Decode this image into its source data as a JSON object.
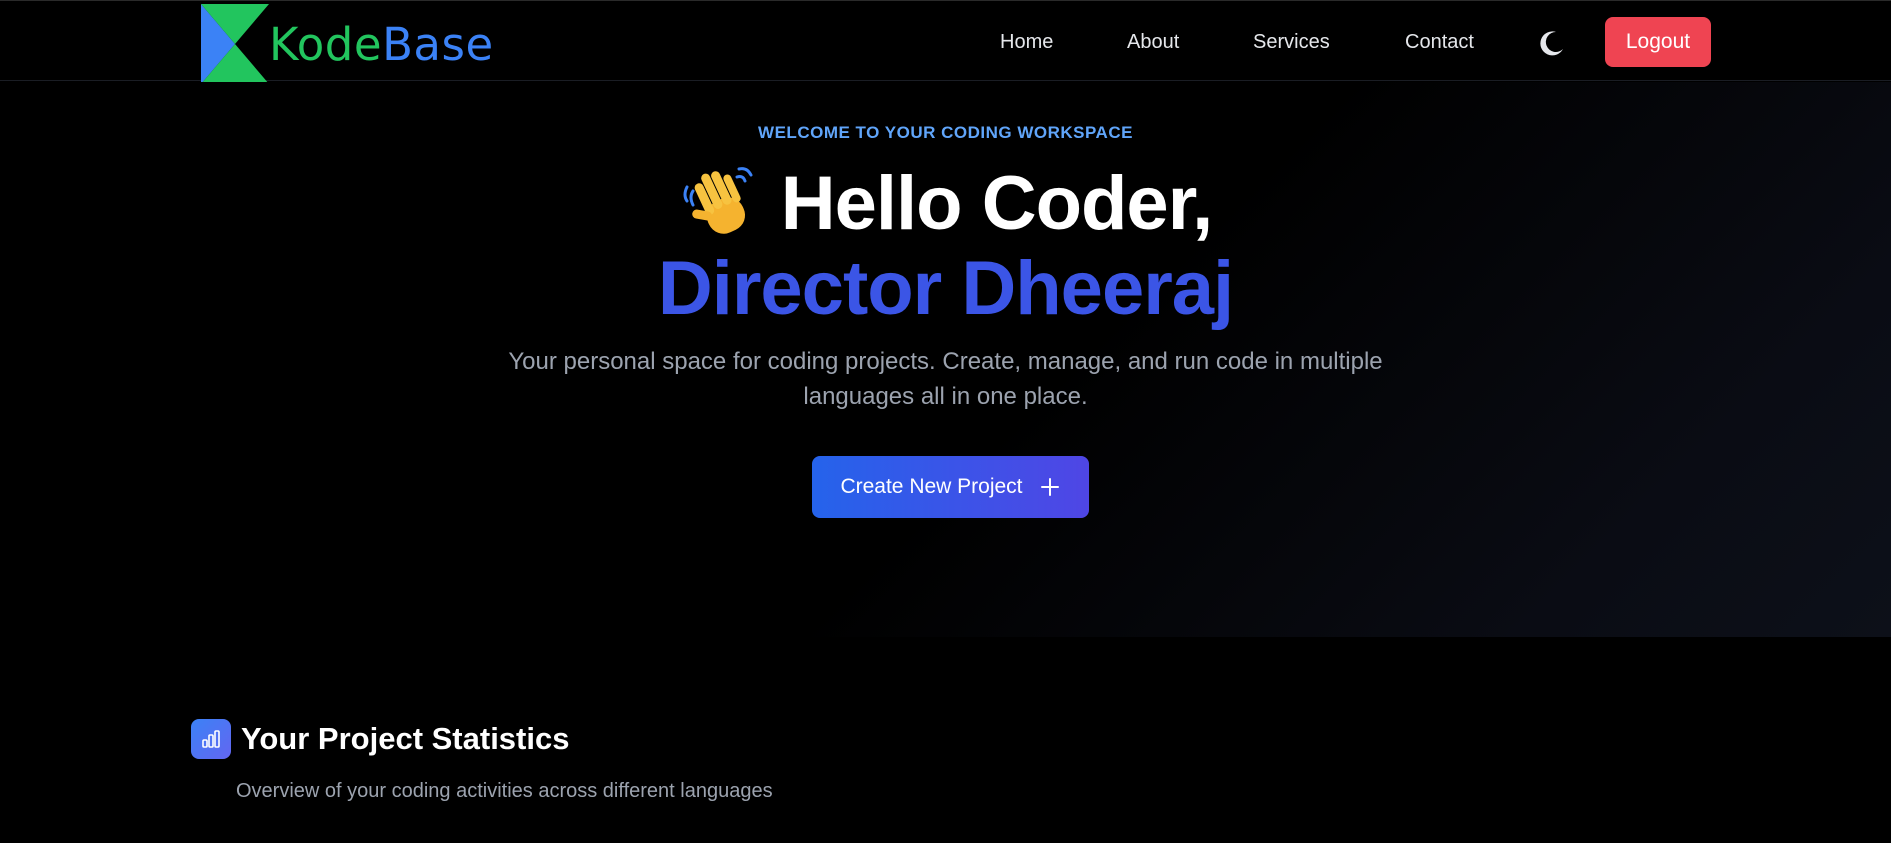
{
  "navbar": {
    "logo": {
      "part1": "Kode",
      "part2": "Base"
    },
    "links": [
      {
        "label": "Home"
      },
      {
        "label": "About"
      },
      {
        "label": "Services"
      },
      {
        "label": "Contact"
      }
    ],
    "theme_icon": "moon-icon",
    "logout_label": "Logout"
  },
  "hero": {
    "eyebrow": "WELCOME TO YOUR CODING WORKSPACE",
    "greeting": "Hello Coder,",
    "greeting_icon": "waving-hand-icon",
    "user_name": "Director Dheeraj",
    "subtitle": "Your personal space for coding projects. Create, manage, and run code in multiple languages all in one place.",
    "cta_label": "Create New Project",
    "cta_icon": "plus-icon"
  },
  "stats": {
    "icon": "bar-chart-icon",
    "title": "Your Project Statistics",
    "description": "Overview of your coding activities across different languages"
  },
  "colors": {
    "background": "#000000",
    "accent_blue": "#3b55e6",
    "eyebrow_blue": "#60a5fa",
    "logo_green": "#22c55e",
    "logo_blue": "#3b82f6",
    "logout_red": "#ef4452"
  }
}
